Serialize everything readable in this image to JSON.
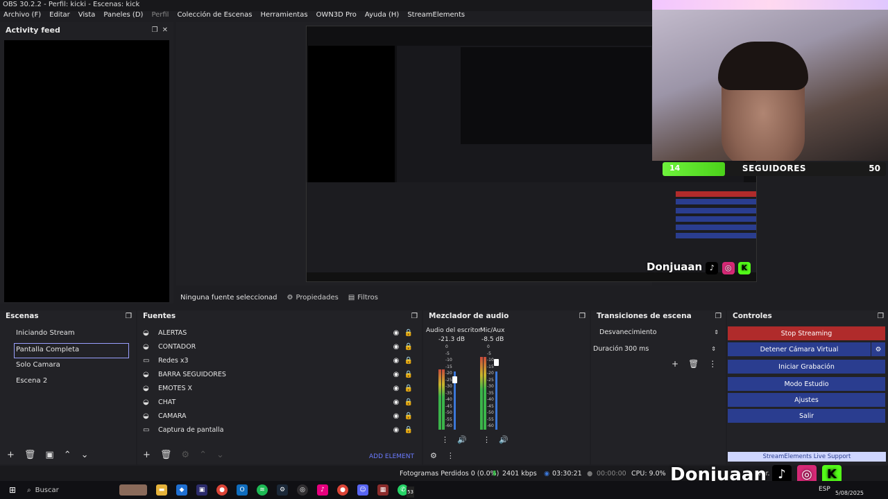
{
  "window_title": "OBS 30.2.2 - Perfil: kicki - Escenas: kick",
  "menu": [
    {
      "label": "Archivo (F)",
      "dim": false
    },
    {
      "label": "Editar",
      "dim": false
    },
    {
      "label": "Vista",
      "dim": false
    },
    {
      "label": "Paneles (D)",
      "dim": false
    },
    {
      "label": "Perfil",
      "dim": true
    },
    {
      "label": "Colección de Escenas",
      "dim": false
    },
    {
      "label": "Herramientas",
      "dim": false
    },
    {
      "label": "OWN3D Pro",
      "dim": false
    },
    {
      "label": "Ayuda (H)",
      "dim": false
    },
    {
      "label": "StreamElements",
      "dim": false
    }
  ],
  "activity_feed": {
    "title": "Activity feed"
  },
  "overlay": {
    "followers_current": "14",
    "followers_label": "SEGUIDORES",
    "followers_goal": "50",
    "followers_progress": 0.28,
    "streamer_name": "Donjuaan"
  },
  "source_bar": {
    "no_source": "Ninguna fuente seleccionad",
    "properties": "Propiedades",
    "filters": "Filtros"
  },
  "scenes": {
    "title": "Escenas",
    "items": [
      "Iniciando Stream",
      "Pantalla Completa",
      "Solo Camara",
      "Escena 2"
    ],
    "selected_index": 1
  },
  "sources": {
    "title": "Fuentes",
    "items": [
      {
        "name": "ALERTAS",
        "icon": "browser-icon"
      },
      {
        "name": "CONTADOR",
        "icon": "browser-icon"
      },
      {
        "name": "Redes x3",
        "icon": "display-icon"
      },
      {
        "name": "BARRA SEGUIDORES",
        "icon": "browser-icon"
      },
      {
        "name": "EMOTES X",
        "icon": "browser-icon"
      },
      {
        "name": "CHAT",
        "icon": "browser-icon"
      },
      {
        "name": "CAMARA",
        "icon": "browser-icon"
      },
      {
        "name": "Captura de pantalla",
        "icon": "display-icon"
      }
    ],
    "add_element": "ADD ELEMENT"
  },
  "mixer": {
    "title": "Mezclador de audio",
    "channels": [
      {
        "name": "Audio del escritor",
        "db": "-21.3 dB",
        "fader": 0.62,
        "level": 0.7
      },
      {
        "name": "Mic/Aux",
        "db": "-8.5 dB",
        "fader": 0.82,
        "level": 0.85
      }
    ],
    "scale": [
      "0",
      "-5",
      "-10",
      "-15",
      "-20",
      "-25",
      "-30",
      "-35",
      "-40",
      "-45",
      "-50",
      "-55",
      "-60"
    ]
  },
  "transitions": {
    "title": "Transiciones de escena",
    "selected": "Desvanecimiento",
    "duration_label": "Duración",
    "duration_value": "300 ms"
  },
  "controls": {
    "title": "Controles",
    "stop_streaming": "Stop Streaming",
    "virtual_camera": "Detener Cámara Virtual",
    "start_recording": "Iniciar Grabación",
    "studio_mode": "Modo Estudio",
    "settings": "Ajustes",
    "exit": "Salir",
    "support": "StreamElements Live Support"
  },
  "status": {
    "dropped_frames": "Fotogramas Perdidos 0 (0.0%)",
    "bitrate": "2401 kbps",
    "stream_time": "03:30:21",
    "rec_time": "00:00:00",
    "cpu": "CPU: 9.0%",
    "version_fragment": "ver. 2"
  },
  "taskbar": {
    "search": "Buscar",
    "date": "5/08/2025",
    "lang": "ESP",
    "badge": "53"
  },
  "colors": {
    "stop_red": "#b02b2b",
    "control_blue": "#2a3d8f",
    "follower_green": "#6ef23c"
  }
}
